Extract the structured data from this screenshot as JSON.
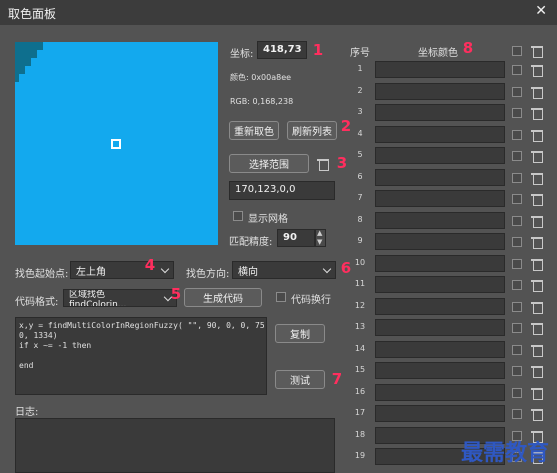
{
  "window": {
    "title": "取色面板"
  },
  "coords": {
    "label": "坐标:",
    "value": "418,73"
  },
  "color_label": "颜色: 0x00a8ee",
  "rgb_label": "RGB: 0,168,238",
  "buttons": {
    "refresh_color": "重新取色",
    "refresh_list": "刷新列表",
    "select_range": "选择范围",
    "generate_code": "生成代码",
    "copy": "复制",
    "test": "测试"
  },
  "range_value": "170,123,0,0",
  "show_grid_label": "显示网格",
  "match_precision": {
    "label": "匹配精度:",
    "value": "90"
  },
  "search_start": {
    "label": "找色起始点:",
    "value": "左上角"
  },
  "search_direction": {
    "label": "找色方向:",
    "value": "横向"
  },
  "code_format": {
    "label": "代码格式:",
    "value": "区域找色 findColorin..."
  },
  "code_wrap_label": "代码换行",
  "code_text": "x,y = findMultiColorInRegionFuzzy( \"\", 90, 0, 0, 75\n0, 1334)\nif x ~= -1 then\n\nend",
  "log_label": "日志:",
  "table": {
    "header_index": "序号",
    "header_color": "坐标颜色",
    "rows": [
      "1",
      "2",
      "3",
      "4",
      "5",
      "6",
      "7",
      "8",
      "9",
      "10",
      "11",
      "12",
      "13",
      "14",
      "15",
      "16",
      "17",
      "18",
      "19"
    ]
  },
  "annotations": [
    "1",
    "2",
    "3",
    "4",
    "5",
    "6",
    "7",
    "8"
  ],
  "watermark": "最需教育",
  "colors": {
    "preview_color": "#13a9ee",
    "preview_corner": "#0e6f8e",
    "annotation": "#ff2e5e",
    "watermark": "#2f58c2"
  }
}
